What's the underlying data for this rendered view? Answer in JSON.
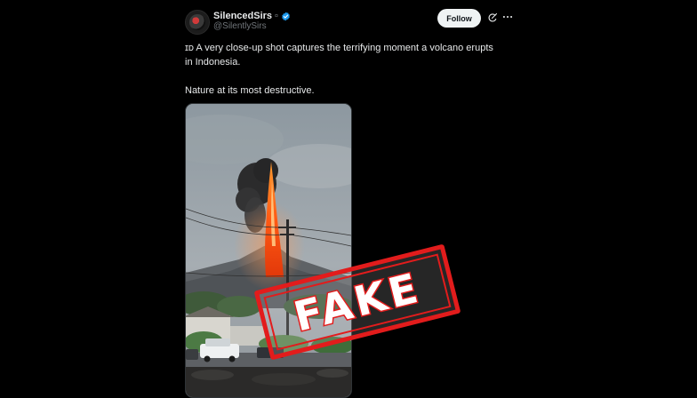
{
  "post": {
    "author": {
      "display_name": "SilencedSirs",
      "affiliate_badge": "¤",
      "handle": "@SilentlySirs",
      "verified": true,
      "avatar_icon": "avatar-icon"
    },
    "follow_label": "Follow",
    "icons": {
      "grok": "grok-icon",
      "more": "more-options-icon",
      "verified": "verified-badge-icon"
    },
    "text_lines": [
      "ɪᴅ A very close-up shot captures the terrifying moment a volcano erupts",
      "in Indonesia.",
      "",
      "Nature at its most destructive."
    ],
    "media": {
      "type": "video-thumbnail",
      "overlay_stamp": "FAKE",
      "stamp_color": "#e21c1c"
    }
  },
  "colors": {
    "background": "#000000",
    "text_primary": "#e7e9ea",
    "text_secondary": "#71767b",
    "verified_blue": "#1d9bf0",
    "follow_bg": "#eff3f4"
  }
}
